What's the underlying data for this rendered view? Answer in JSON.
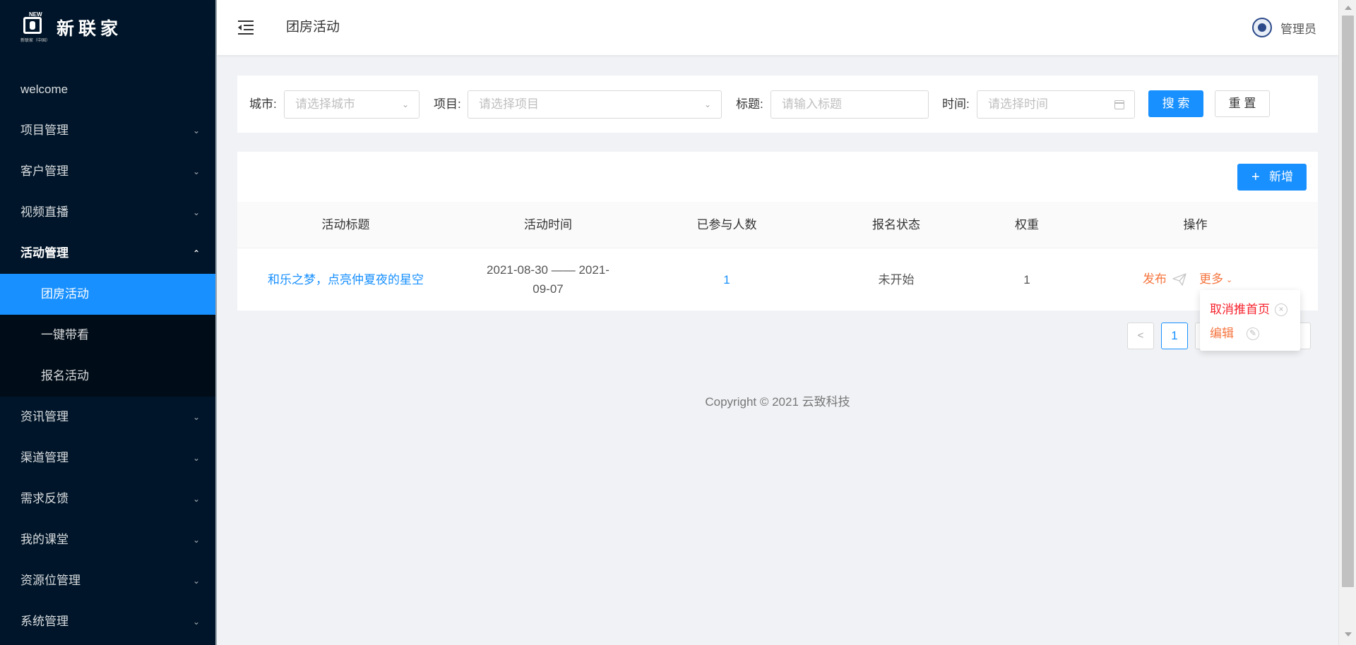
{
  "app": {
    "logo_badge": "NEW",
    "logo_sub": "新联家（中国）",
    "logo_text": "新联家"
  },
  "sidebar": {
    "items": [
      {
        "label": "welcome"
      },
      {
        "label": "项目管理",
        "chevron": "chevron-down-icon"
      },
      {
        "label": "客户管理",
        "chevron": "chevron-down-icon"
      },
      {
        "label": "视频直播",
        "chevron": "chevron-down-icon"
      },
      {
        "label": "活动管理",
        "chevron": "chevron-up-icon",
        "open": true
      },
      {
        "label": "资讯管理",
        "chevron": "chevron-down-icon"
      },
      {
        "label": "渠道管理",
        "chevron": "chevron-down-icon"
      },
      {
        "label": "需求反馈",
        "chevron": "chevron-down-icon"
      },
      {
        "label": "我的课堂",
        "chevron": "chevron-down-icon"
      },
      {
        "label": "资源位管理",
        "chevron": "chevron-down-icon"
      },
      {
        "label": "系统管理",
        "chevron": "chevron-down-icon"
      }
    ],
    "submenu": [
      {
        "label": "团房活动",
        "active": true
      },
      {
        "label": "一键带看"
      },
      {
        "label": "报名活动"
      }
    ]
  },
  "header": {
    "title": "团房活动",
    "user": "管理员"
  },
  "filters": {
    "city_label": "城市:",
    "city_placeholder": "请选择城市",
    "project_label": "项目:",
    "project_placeholder": "请选择项目",
    "title_label": "标题:",
    "title_placeholder": "请输入标题",
    "time_label": "时间:",
    "time_placeholder": "请选择时间",
    "search_button": "搜 索",
    "reset_button": "重 置"
  },
  "table": {
    "add_button": "新增",
    "columns": [
      "活动标题",
      "活动时间",
      "已参与人数",
      "报名状态",
      "权重",
      "操作"
    ],
    "rows": [
      {
        "title": "和乐之梦，点亮仲夏夜的星空",
        "time_line1": "2021-08-30 —— 2021-",
        "time_line2": "09-07",
        "participants": "1",
        "status": "未开始",
        "weight": "1",
        "op_publish": "发布",
        "op_more": "更多"
      }
    ]
  },
  "dropdown": {
    "items": [
      {
        "label": "取消推首页",
        "color": "#f5222d",
        "icon": "close-circle-icon"
      },
      {
        "label": "编辑",
        "color": "#f5753f",
        "icon": "edit-circle-icon"
      }
    ]
  },
  "pagination": {
    "current": "1"
  },
  "footer": {
    "copyright": "Copyright © 2021 云致科技"
  },
  "colors": {
    "sidebar_bg": "#001529",
    "submenu_bg": "#000c17",
    "primary": "#1890ff",
    "warning_orange": "#f5753f",
    "danger_red": "#f5222d"
  }
}
